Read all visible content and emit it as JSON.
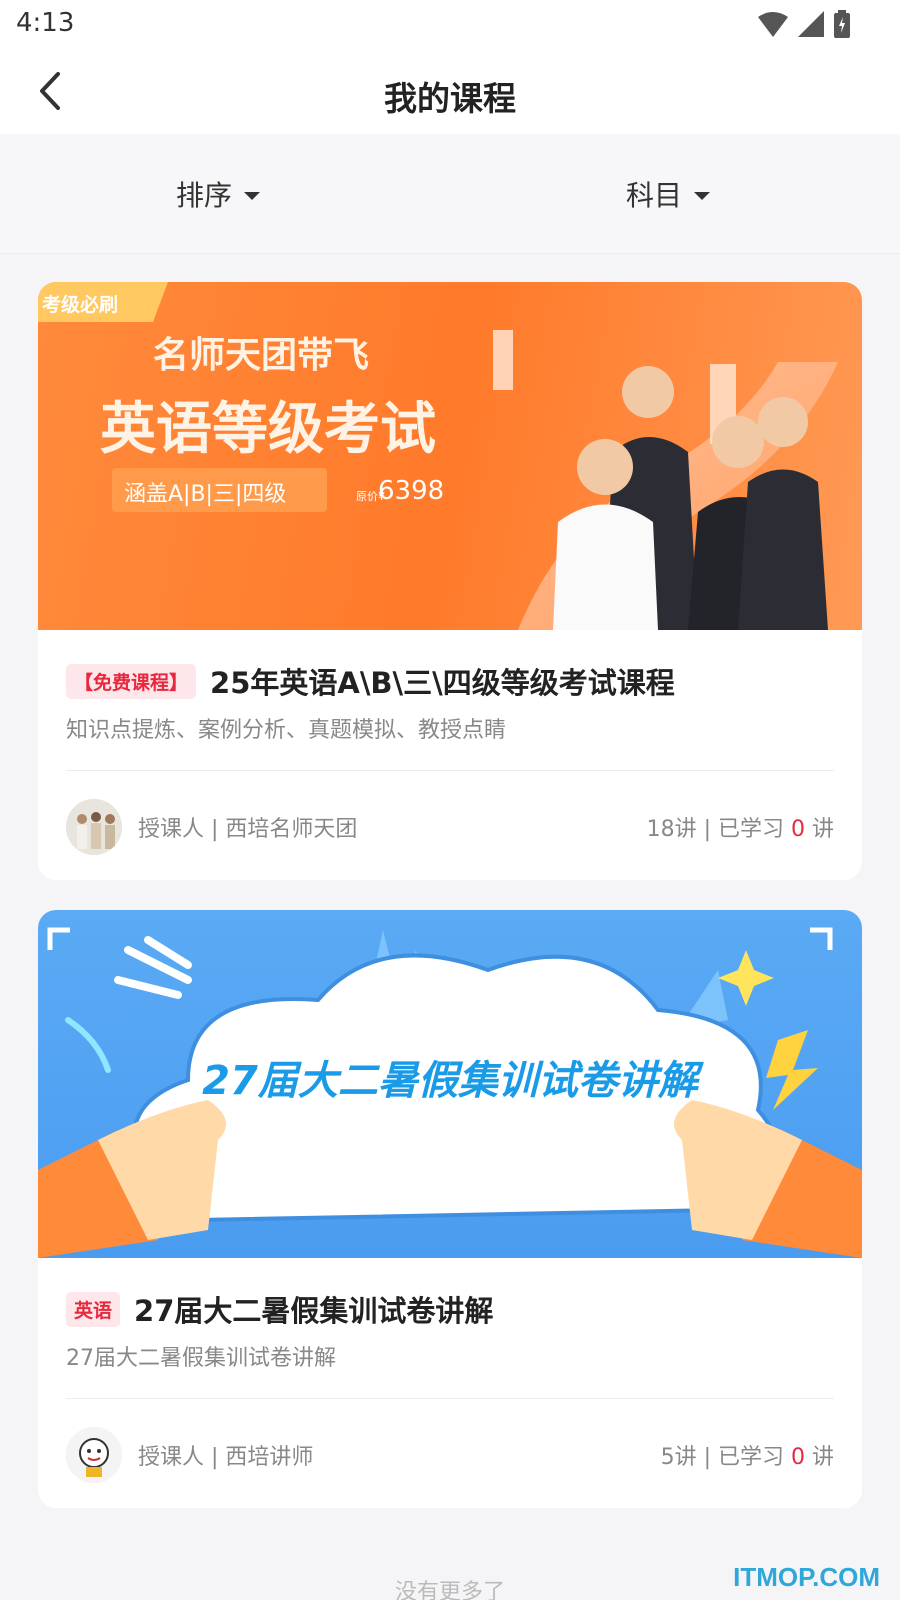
{
  "status_bar": {
    "time": "4:13"
  },
  "header": {
    "title": "我的课程"
  },
  "filters": {
    "sort_label": "排序",
    "subject_label": "科目"
  },
  "courses": [
    {
      "banner": {
        "corner_tag": "考级必刷",
        "headline1": "名师天团带飞",
        "headline2": "英语等级考试",
        "subtext": "涵盖A|B|三|四级",
        "price_label": "原价¥",
        "price": "6398"
      },
      "tag": "【免费课程】",
      "title": "25年英语A\\B\\三\\四级等级考试课程",
      "description": "知识点提炼、案例分析、真题模拟、教授点睛",
      "teacher": "授课人 | 西培名师天团",
      "lessons_prefix": "18讲 | 已学习 ",
      "learned": "0",
      "lessons_suffix": " 讲"
    },
    {
      "banner": {
        "headline": "27届大二暑假集训试卷讲解"
      },
      "tag": "英语",
      "title": "27届大二暑假集训试卷讲解",
      "description": "27届大二暑假集训试卷讲解",
      "teacher": "授课人 | 西培讲师",
      "lessons_prefix": "5讲 | 已学习 ",
      "learned": "0",
      "lessons_suffix": " 讲"
    }
  ],
  "footer": {
    "no_more": "没有更多了"
  },
  "watermark": "ITMOP.COM",
  "colors": {
    "accent_red": "#e8283f",
    "banner_orange": "#ff7a2a",
    "banner_blue": "#4a9cf0"
  }
}
